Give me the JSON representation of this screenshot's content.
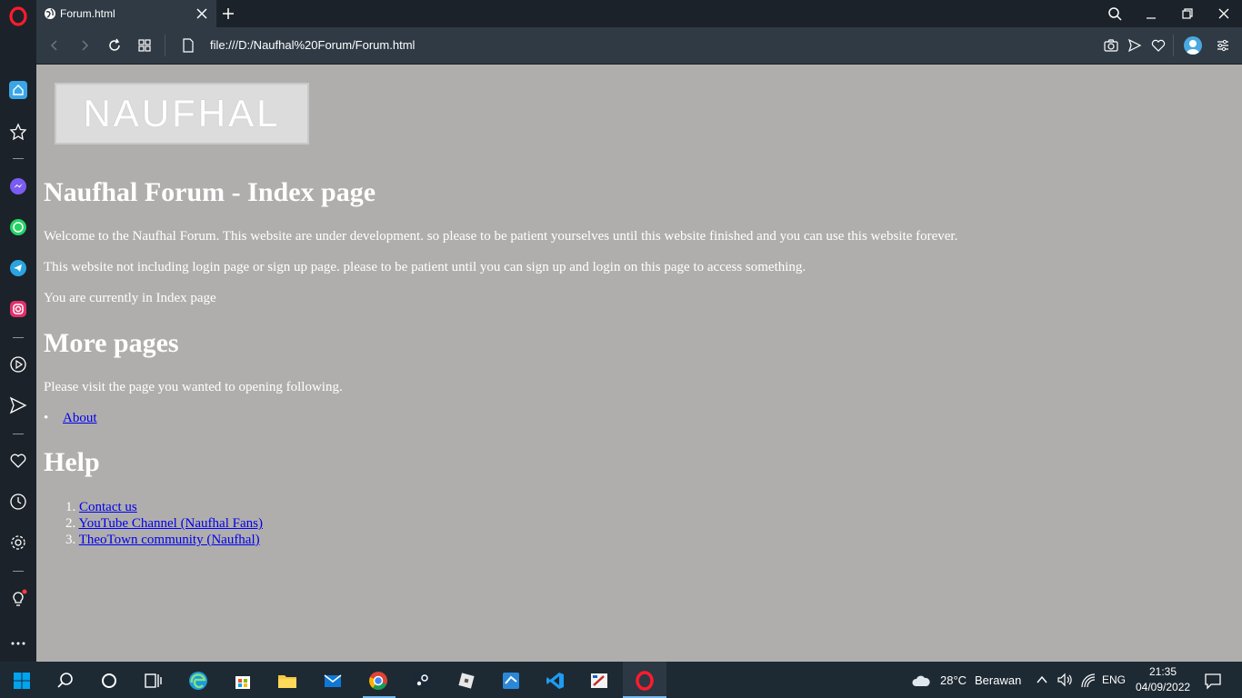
{
  "browser": {
    "tab_title": "Forum.html",
    "url": "file:///D:/Naufhal%20Forum/Forum.html"
  },
  "page": {
    "logo_text": "NAUFHAL",
    "heading_index": "Naufhal Forum - Index page",
    "para1": "Welcome to the Naufhal Forum. This website are under development. so please to be patient yourselves until this website finished and you can use this website forever.",
    "para2": "This website not including login page or sign up page. please to be patient until you can sign up and login on this page to access something.",
    "para3": "You are currently in Index page",
    "heading_more": "More pages",
    "para4": "Please visit the page you wanted to opening following.",
    "more_links": [
      "About"
    ],
    "heading_help": "Help",
    "help_links": [
      {
        "num": "1.",
        "label": "Contact us"
      },
      {
        "num": "2.",
        "label": "YouTube Channel (Naufhal Fans)"
      },
      {
        "num": "3.",
        "label": "TheoTown community (Naufhal)"
      }
    ]
  },
  "taskbar": {
    "weather_temp": "28°C",
    "weather_desc": "Berawan",
    "language": "ENG",
    "time": "21:35",
    "date": "04/09/2022"
  },
  "colors": {
    "page_background": "#b0aeac",
    "link": "#0000ee",
    "opera_red": "#ff1b2d"
  }
}
